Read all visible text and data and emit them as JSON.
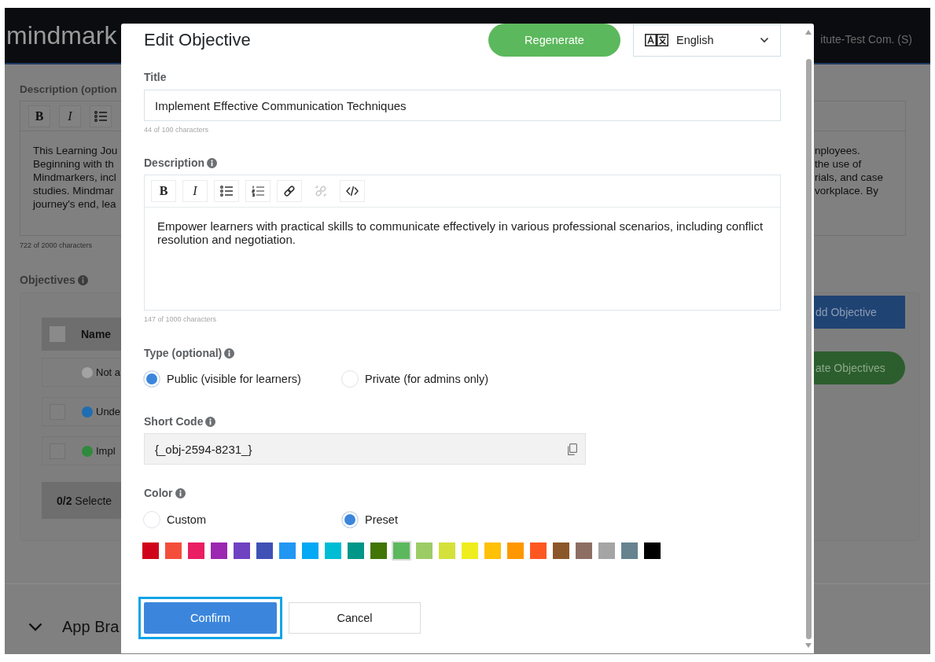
{
  "header": {
    "logo": "mindmark",
    "account": "itute-Test Com. (S)"
  },
  "page": {
    "description": {
      "label": "Description (option",
      "toolbar": [
        {
          "kind": "bold",
          "label": "B"
        },
        {
          "kind": "italic",
          "label": "I"
        },
        {
          "kind": "bullet-list"
        }
      ],
      "text_left": [
        "This Learning Jou",
        "Beginning with th",
        "Mindmarkers, incl",
        "studies. Mindmar",
        "journey's end, lea"
      ],
      "text_right": [
        "nployees.",
        "the use of",
        "rials, and case",
        "vorkplace. By"
      ],
      "counter": "722 of 2000 characters"
    },
    "objectives": {
      "label": "Objectives",
      "info": true,
      "table": {
        "columns": [
          "Name"
        ],
        "select_all": {
          "checked": false
        },
        "rows": [
          {
            "kind": "plain",
            "name": "Not a",
            "color": "#a3a3a3"
          },
          {
            "kind": "checkbox",
            "checked": false,
            "name": "Unde",
            "color": "#1f6db3"
          },
          {
            "kind": "checkbox",
            "checked": false,
            "name": "Impl",
            "color": "#2f8a3b"
          }
        ],
        "footer": "**0/2** Selecte"
      },
      "buttons": [
        {
          "kind": "primary",
          "label": "dd Objective"
        },
        {
          "kind": "pill",
          "label": "ate Objectives"
        }
      ]
    },
    "sections": [
      {
        "title": "App Bra"
      }
    ]
  },
  "dialog": {
    "title": "Edit Objective",
    "regenerate_button": "Regenerate",
    "language": {
      "value": "English"
    },
    "title_field": {
      "label": "Title",
      "value": "Implement Effective Communication Techniques",
      "counter": "44 of 100 characters"
    },
    "description": {
      "label": "Description",
      "info": true,
      "toolbar": [
        {
          "kind": "bold",
          "label": "B",
          "disabled": false
        },
        {
          "kind": "italic",
          "label": "I",
          "disabled": false
        },
        {
          "kind": "bullet-list",
          "disabled": false
        },
        {
          "kind": "numbered-list",
          "disabled": false
        },
        {
          "kind": "link",
          "disabled": false
        },
        {
          "kind": "unlink",
          "disabled": true
        },
        {
          "kind": "code",
          "disabled": false
        }
      ],
      "text": "Empower learners with practical skills to communicate effectively in various professional scenarios, including conflict resolution and negotiation.",
      "counter": "147 of 1000 characters"
    },
    "type": {
      "label": "Type (optional)",
      "info": true,
      "options": [
        {
          "label": "Public (visible for learners)",
          "selected": true
        },
        {
          "label": "Private (for admins only)",
          "selected": false
        }
      ]
    },
    "short_code": {
      "label": "Short Code",
      "info": true,
      "value": "{_obj-2594-8231_}"
    },
    "color": {
      "label": "Color",
      "info": true,
      "options": [
        {
          "label": "Custom",
          "selected": false
        },
        {
          "label": "Preset",
          "selected": true
        }
      ],
      "swatches": [
        {
          "color": "#d0021b",
          "selected": false
        },
        {
          "color": "#f44e3b",
          "selected": false
        },
        {
          "color": "#e91e63",
          "selected": false
        },
        {
          "color": "#9c27b0",
          "selected": false
        },
        {
          "color": "#6f42c1",
          "selected": false
        },
        {
          "color": "#3f51b5",
          "selected": false
        },
        {
          "color": "#2196f3",
          "selected": false
        },
        {
          "color": "#03a9f4",
          "selected": false
        },
        {
          "color": "#00bcd4",
          "selected": false
        },
        {
          "color": "#009688",
          "selected": false
        },
        {
          "color": "#417505",
          "selected": false
        },
        {
          "color": "#5cb85c",
          "selected": true
        },
        {
          "color": "#9ccc65",
          "selected": false
        },
        {
          "color": "#d4e13b",
          "selected": false
        },
        {
          "color": "#f0ed1e",
          "selected": false
        },
        {
          "color": "#ffc107",
          "selected": false
        },
        {
          "color": "#ff9800",
          "selected": false
        },
        {
          "color": "#ff5722",
          "selected": false
        },
        {
          "color": "#8b572a",
          "selected": false
        },
        {
          "color": "#8d6e63",
          "selected": false
        },
        {
          "color": "#a5a5a5",
          "selected": false
        },
        {
          "color": "#66838f",
          "selected": false
        },
        {
          "color": "#000000",
          "selected": false
        }
      ]
    },
    "buttons": [
      {
        "kind": "primary",
        "label": "Confirm",
        "focused": true
      },
      {
        "kind": "secondary",
        "label": "Cancel",
        "focused": false
      }
    ]
  }
}
